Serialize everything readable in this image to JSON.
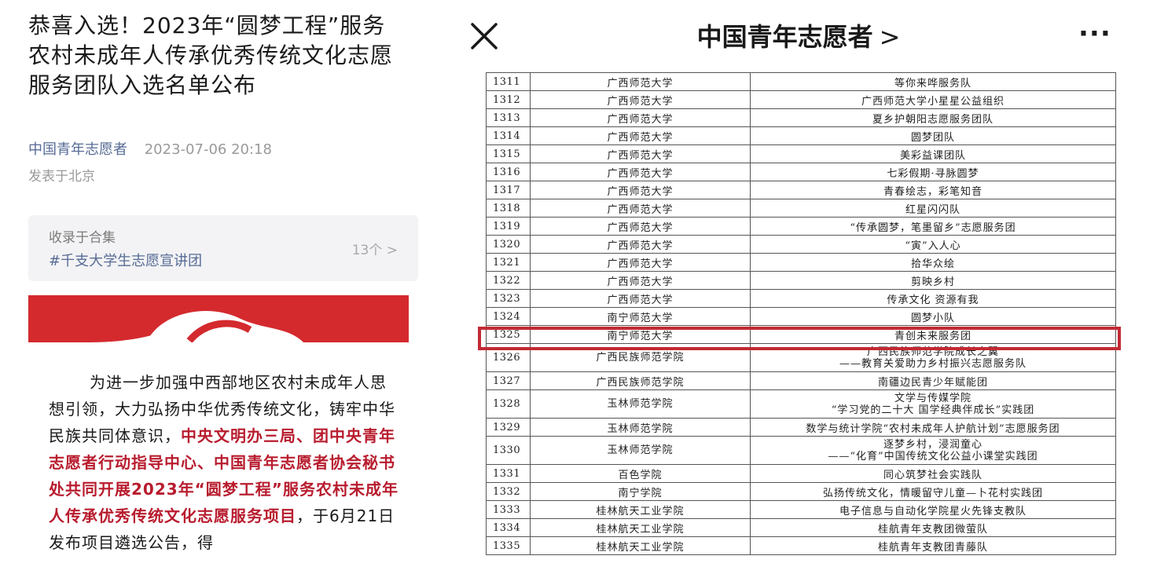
{
  "article": {
    "title": "恭喜入选！2023年“圆梦工程”服务农村未成年人传承优秀传统文化志愿服务团队入选名单公布",
    "author": "中国青年志愿者",
    "datetime": "2023-07-06 20:18",
    "location": "发表于北京",
    "collection": {
      "label": "收录于合集",
      "name": "#千支大学生志愿宣讲团",
      "count": "13个 >"
    },
    "paragraph": {
      "part1": "为进一步加强中西部地区农村未成年人思想引领，大力弘扬中华优秀传统文化，铸牢中华民族共同体意识，",
      "part2_red": "中央文明办三局、团中央青年志愿者行动指导中心、中国青年志愿者协会秘书处共同开展2023年“圆梦工程”服务农村未成年人传承优秀传统文化志愿服务项目",
      "part3": "，于6月21日发布项目遴选公告，得"
    }
  },
  "nav": {
    "title": "中国青年志愿者",
    "chevron": ">",
    "more": "···"
  },
  "colors": {
    "accent_red": "#b81c2e",
    "link_blue": "#576b95",
    "highlight_border": "#c22a34"
  },
  "table": {
    "rows": [
      {
        "num": "1311",
        "school": "广西师范大学",
        "team": [
          "等你来哗服务队"
        ]
      },
      {
        "num": "1312",
        "school": "广西师范大学",
        "team": [
          "广西师范大学小星星公益组织"
        ]
      },
      {
        "num": "1313",
        "school": "广西师范大学",
        "team": [
          "夏乡护朝阳志愿服务团队"
        ]
      },
      {
        "num": "1314",
        "school": "广西师范大学",
        "team": [
          "圆梦团队"
        ]
      },
      {
        "num": "1315",
        "school": "广西师范大学",
        "team": [
          "美彩益课团队"
        ]
      },
      {
        "num": "1316",
        "school": "广西师范大学",
        "team": [
          "七彩假期·寻脉圆梦"
        ]
      },
      {
        "num": "1317",
        "school": "广西师范大学",
        "team": [
          "青春绘志，彩笔知音"
        ]
      },
      {
        "num": "1318",
        "school": "广西师范大学",
        "team": [
          "红星闪闪队"
        ]
      },
      {
        "num": "1319",
        "school": "广西师范大学",
        "team": [
          "“传承圆梦，笔墨留乡”志愿服务团"
        ]
      },
      {
        "num": "1320",
        "school": "广西师范大学",
        "team": [
          "“寅”入人心"
        ]
      },
      {
        "num": "1321",
        "school": "广西师范大学",
        "team": [
          "拾华众绘"
        ]
      },
      {
        "num": "1322",
        "school": "广西师范大学",
        "team": [
          "剪映乡村"
        ]
      },
      {
        "num": "1323",
        "school": "广西师范大学",
        "team": [
          "传承文化 资源有我"
        ]
      },
      {
        "num": "1324",
        "school": "南宁师范大学",
        "team": [
          "圆梦小队"
        ]
      },
      {
        "num": "1325",
        "school": "南宁师范大学",
        "team": [
          "青创未来服务团"
        ]
      },
      {
        "num": "1326",
        "school": "广西民族师范学院",
        "team": [
          "广西民族师范学院成长之翼",
          "——教育关爱助力乡村振兴志愿服务队"
        ]
      },
      {
        "num": "1327",
        "school": "广西民族师范学院",
        "team": [
          "南疆边民青少年赋能团"
        ]
      },
      {
        "num": "1328",
        "school": "玉林师范学院",
        "team": [
          "文学与传媒学院",
          "“学习党的二十大  国学经典伴成长”实践团"
        ]
      },
      {
        "num": "1329",
        "school": "玉林师范学院",
        "team": [
          "数学与统计学院“农村未成年人护航计划”志愿服务团"
        ]
      },
      {
        "num": "1330",
        "school": "玉林师范学院",
        "team": [
          "逐梦乡村，浸润童心",
          "——“化育”中国传统文化公益小课堂实践团"
        ]
      },
      {
        "num": "1331",
        "school": "百色学院",
        "team": [
          "同心筑梦社会实践队"
        ]
      },
      {
        "num": "1332",
        "school": "南宁学院",
        "team": [
          "弘扬传统文化，情暖留守儿童—卜花村实践团"
        ]
      },
      {
        "num": "1333",
        "school": "桂林航天工业学院",
        "team": [
          "电子信息与自动化学院星火先锋支教队"
        ]
      },
      {
        "num": "1334",
        "school": "桂林航天工业学院",
        "team": [
          "桂航青年支教团微萤队"
        ]
      },
      {
        "num": "1335",
        "school": "桂林航天工业学院",
        "team": [
          "桂航青年支教团青藤队"
        ]
      }
    ]
  }
}
